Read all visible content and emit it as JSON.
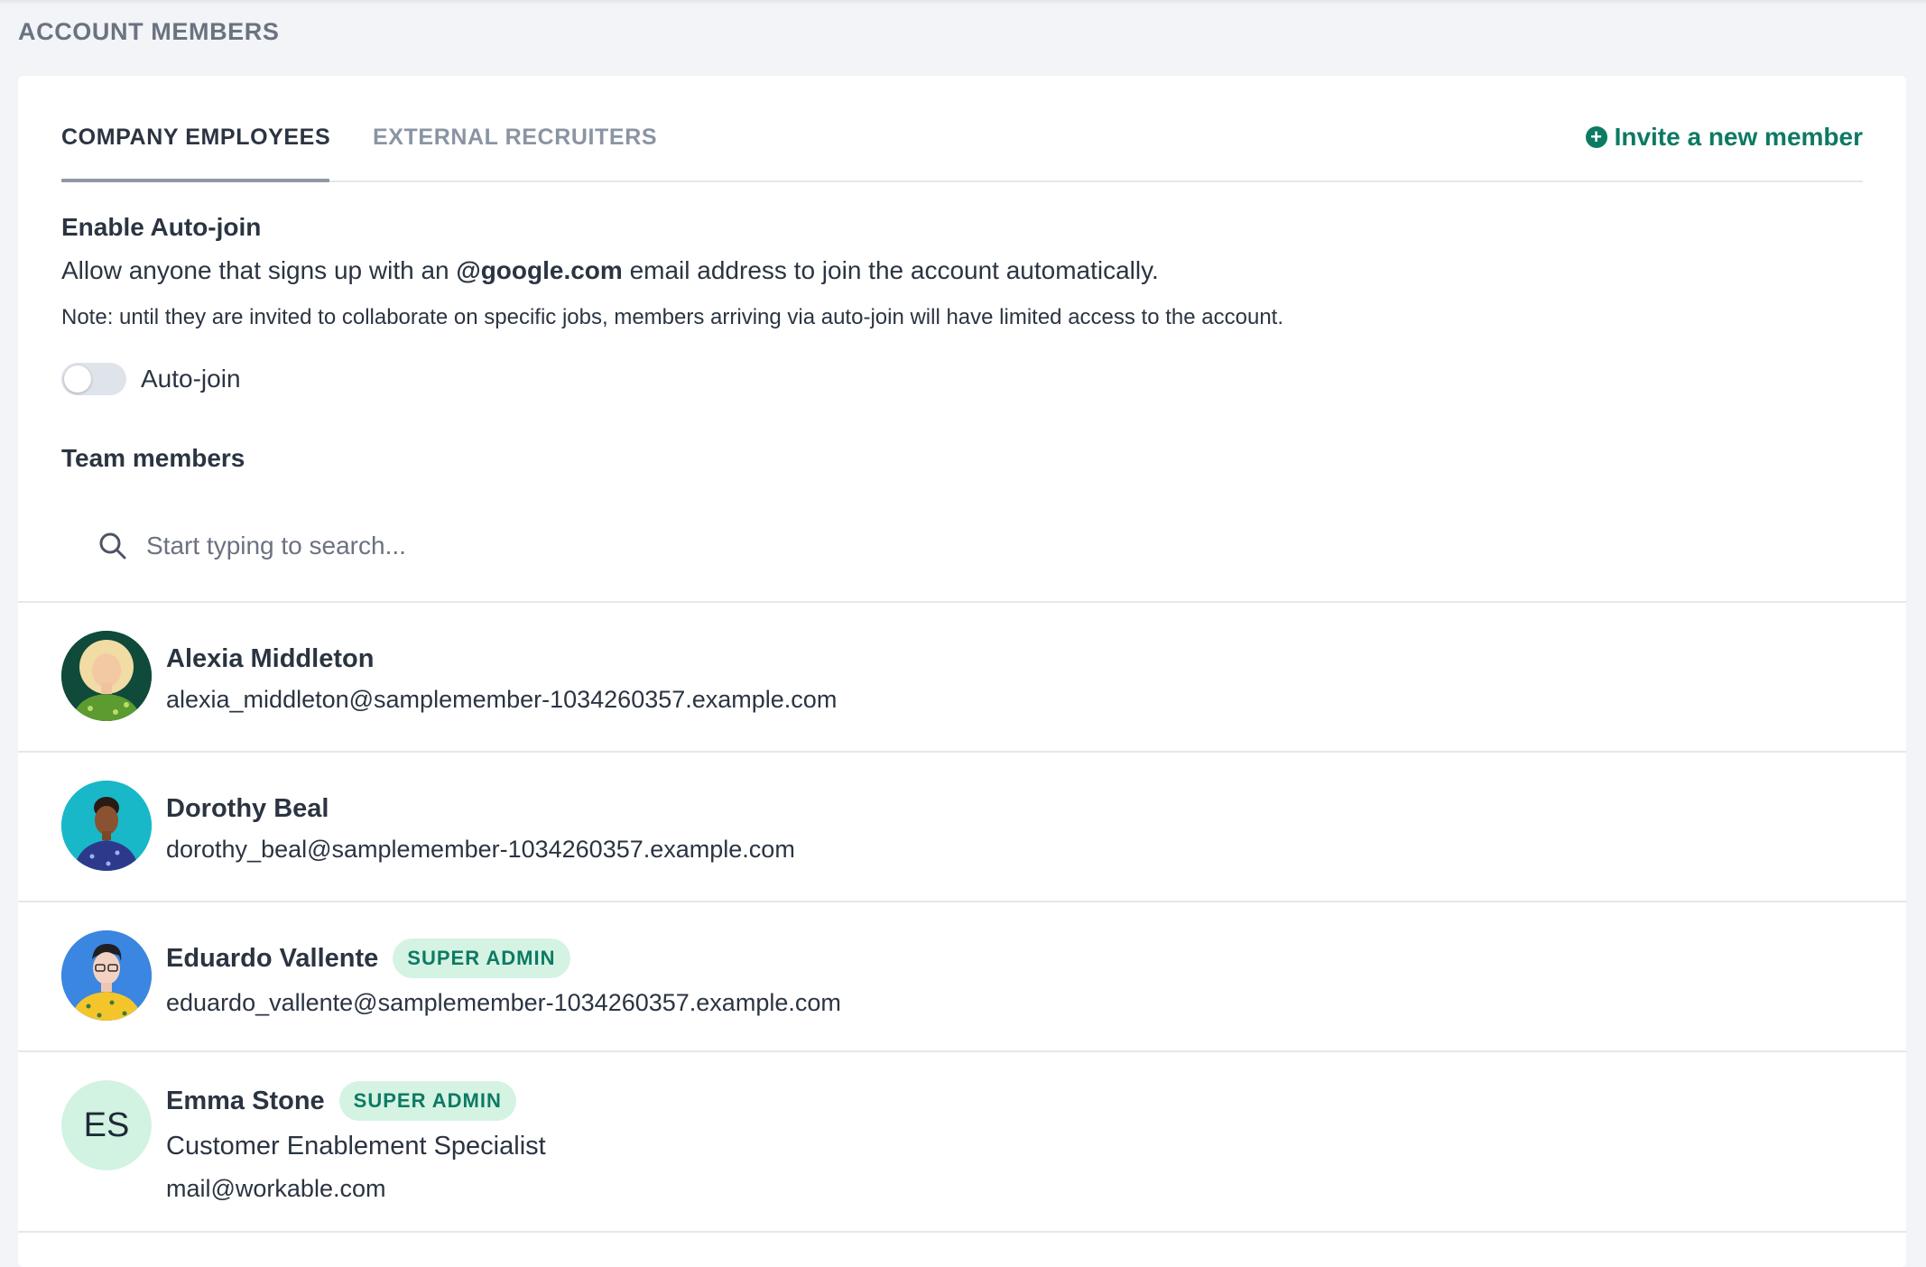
{
  "page_title": "ACCOUNT MEMBERS",
  "tabs": [
    {
      "label": "COMPANY EMPLOYEES",
      "active": true
    },
    {
      "label": "EXTERNAL RECRUITERS",
      "active": false
    }
  ],
  "invite_label": "Invite a new member",
  "autojoin": {
    "heading": "Enable Auto-join",
    "desc_before": "Allow anyone that signs up with an ",
    "desc_domain": "@google.com",
    "desc_after": " email address to join the account automatically.",
    "note": "Note: until they are invited to collaborate on specific jobs, members arriving via auto-join will have limited access to the account.",
    "toggle_label": "Auto-join",
    "enabled": false
  },
  "team": {
    "heading": "Team members",
    "search_placeholder": "Start typing to search..."
  },
  "members": [
    {
      "name": "Alexia Middleton",
      "email": "alexia_middleton@samplemember-1034260357.example.com",
      "badge": "",
      "role": ""
    },
    {
      "name": "Dorothy Beal",
      "email": "dorothy_beal@samplemember-1034260357.example.com",
      "badge": "",
      "role": ""
    },
    {
      "name": "Eduardo Vallente",
      "email": "eduardo_vallente@samplemember-1034260357.example.com",
      "badge": "SUPER ADMIN",
      "role": ""
    },
    {
      "name": "Emma Stone",
      "email": "mail@workable.com",
      "badge": "SUPER ADMIN",
      "role": "Customer Enablement Specialist",
      "initials": "ES"
    }
  ],
  "colors": {
    "accent": "#0d7a63",
    "badge_bg": "#d5f3e3"
  }
}
